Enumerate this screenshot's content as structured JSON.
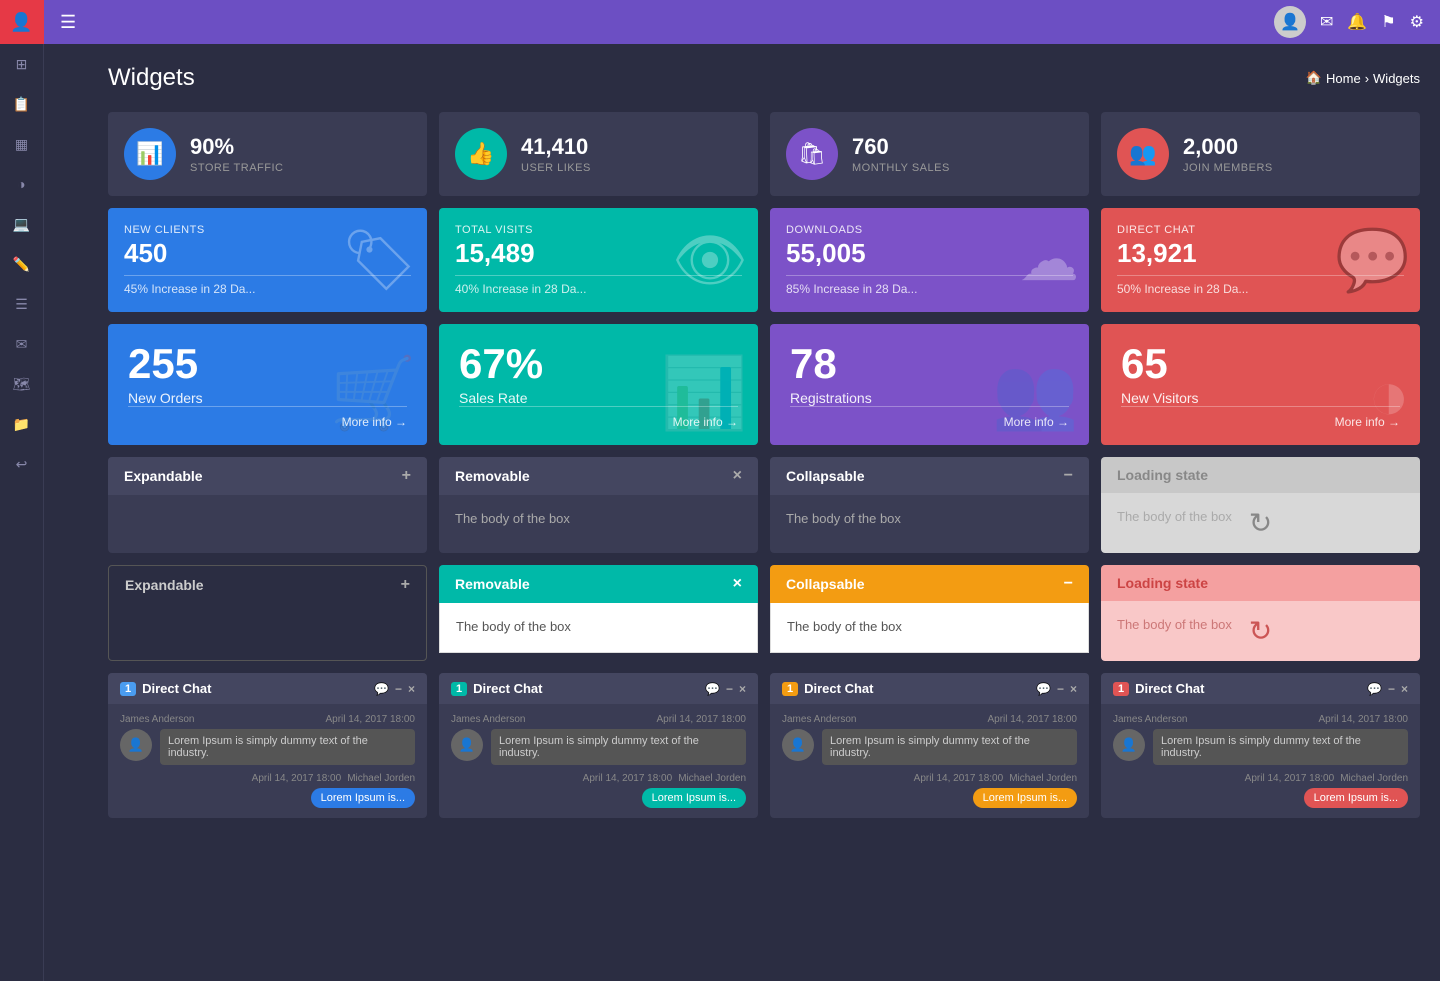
{
  "app": {
    "title": "Widgets",
    "breadcrumb_home": "Home",
    "breadcrumb_current": "Widgets"
  },
  "sidebar": {
    "icons": [
      "👤",
      "📋",
      "⊞",
      "◑",
      "💻",
      "✏️",
      "☰",
      "✉",
      "🗺",
      "📁",
      "↩"
    ]
  },
  "topnav": {
    "hamburger": "☰",
    "icons": [
      "✉",
      "🔔",
      "⚑",
      "⚙"
    ]
  },
  "stat_cards_row1": [
    {
      "icon": "📊",
      "icon_bg": "#2c7be5",
      "number": "90%",
      "label": "STORE TRAFFIC"
    },
    {
      "icon": "👍",
      "icon_bg": "#00b9a8",
      "number": "41,410",
      "label": "USER LIKES"
    },
    {
      "icon": "🛍",
      "icon_bg": "#7c52c8",
      "number": "760",
      "label": "MONTHLY SALES"
    },
    {
      "icon": "👥",
      "icon_bg": "#e05454",
      "number": "2,000",
      "label": "JOIN MEMBERS"
    }
  ],
  "info_cards_row2": [
    {
      "sublabel": "NEW CLIENTS",
      "number": "450",
      "desc": "45% Increase in 28 Da...",
      "icon": "🏷",
      "bg": "#2c7be5"
    },
    {
      "sublabel": "TOTAL VISITS",
      "number": "15,489",
      "desc": "40% Increase in 28 Da...",
      "icon": "👁",
      "bg": "#00b9a8"
    },
    {
      "sublabel": "DOWNLOADS",
      "number": "55,005",
      "desc": "85% Increase in 28 Da...",
      "icon": "☁",
      "bg": "#7c52c8"
    },
    {
      "sublabel": "DIRECT CHAT",
      "number": "13,921",
      "desc": "50% Increase in 28 Da...",
      "icon": "💬",
      "bg": "#e05454"
    }
  ],
  "big_stat_cards_row3": [
    {
      "number": "255",
      "label": "New Orders",
      "footer": "More info →",
      "bg": "#2c7be5",
      "icon": "🛒"
    },
    {
      "number": "67%",
      "label": "Sales Rate",
      "footer": "More info →",
      "bg": "#00b9a8",
      "icon": "📊"
    },
    {
      "number": "78",
      "label": "Registrations",
      "footer": "More info →",
      "bg": "#7c52c8",
      "icon": "👥"
    },
    {
      "number": "65",
      "label": "New Visitors",
      "footer": "More info →",
      "bg": "#e05454",
      "icon": "◑"
    }
  ],
  "box_cards_row4": [
    {
      "title": "Expandable",
      "body": "",
      "type": "dark",
      "action": "+"
    },
    {
      "title": "Removable",
      "body": "The body of the box",
      "type": "dark",
      "action": "×"
    },
    {
      "title": "Collapsable",
      "body": "The body of the box",
      "type": "dark",
      "action": "−"
    },
    {
      "title": "Loading state",
      "body": "The body of the box",
      "type": "loading"
    }
  ],
  "box_cards_row5": [
    {
      "title": "Expandable",
      "body": "",
      "type": "outline",
      "action": "+",
      "color": "outline-dark"
    },
    {
      "title": "Removable",
      "body": "The body of the box",
      "type": "colored",
      "color": "teal",
      "action": "×"
    },
    {
      "title": "Collapsable",
      "body": "The body of the box",
      "type": "colored",
      "color": "orange",
      "action": "−"
    },
    {
      "title": "Loading state",
      "body": "The body of the box",
      "type": "loading-pink"
    }
  ],
  "chat_cards": [
    {
      "title": "Direct Chat",
      "badge": "1",
      "from_name": "James Anderson",
      "from_date": "April 14, 2017 18:00",
      "from_msg": "Lorem Ipsum is simply dummy text of the industry.",
      "to_name": "Michael Jorden",
      "to_date": "April 14, 2017 18:00",
      "to_msg": "Lorem Ipsum is...",
      "color": "blue"
    },
    {
      "title": "Direct Chat",
      "badge": "1",
      "from_name": "James Anderson",
      "from_date": "April 14, 2017 18:00",
      "from_msg": "Lorem Ipsum is simply dummy text of the industry.",
      "to_name": "Michael Jorden",
      "to_date": "April 14, 2017 18:00",
      "to_msg": "Lorem Ipsum is...",
      "color": "teal"
    },
    {
      "title": "Direct Chat",
      "badge": "1",
      "from_name": "James Anderson",
      "from_date": "April 14, 2017 18:00",
      "from_msg": "Lorem Ipsum is simply dummy text of the industry.",
      "to_name": "Michael Jorden",
      "to_date": "April 14, 2017 18:00",
      "to_msg": "Lorem Ipsum is...",
      "color": "orange"
    },
    {
      "title": "Direct Chat",
      "badge": "1",
      "from_name": "James Anderson",
      "from_date": "April 14, 2017 18:00",
      "from_msg": "Lorem Ipsum is simply dummy text of the industry.",
      "to_name": "Michael Jorden",
      "to_date": "April 14, 2017 18:00",
      "to_msg": "Lorem Ipsum is...",
      "color": "red"
    }
  ]
}
